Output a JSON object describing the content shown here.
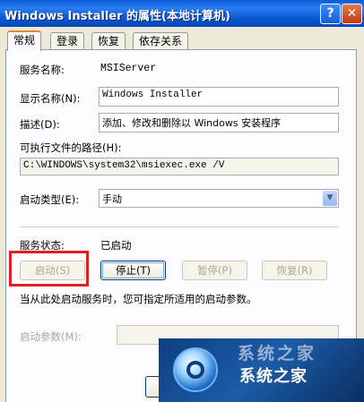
{
  "window": {
    "title": "Windows Installer 的属性(本地计算机)",
    "help_label": "?",
    "close_label": "✕"
  },
  "tabs": [
    {
      "label": "常规",
      "active": true
    },
    {
      "label": "登录",
      "active": false
    },
    {
      "label": "恢复",
      "active": false
    },
    {
      "label": "依存关系",
      "active": false
    }
  ],
  "general": {
    "service_name_label": "服务名称:",
    "service_name_value": "MSIServer",
    "display_name_label": "显示名称(N):",
    "display_name_value": "Windows Installer",
    "description_label": "描述(D):",
    "description_value": "添加、修改和删除以 Windows 安装程序",
    "exe_path_label": "可执行文件的路径(H):",
    "exe_path_value": "C:\\WINDOWS\\system32\\msiexec.exe /V",
    "startup_type_label": "启动类型(E):",
    "startup_type_value": "手动",
    "status_label": "服务状态:",
    "status_value": "已启动",
    "hint_text": "当从此处启动服务时，您可指定所适用的启动参数。",
    "start_params_label": "启动参数(M):",
    "start_params_value": ""
  },
  "buttons": {
    "start": "启动(S)",
    "stop": "停止(T)",
    "pause": "暂停(P)",
    "resume": "恢复(R)"
  },
  "watermark": {
    "ghost_text": "系统之家",
    "text": "系统之家"
  }
}
